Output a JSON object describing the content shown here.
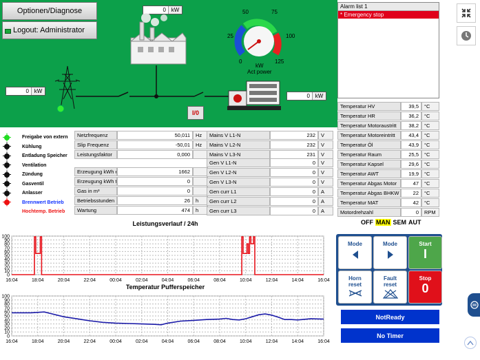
{
  "header": {
    "options_label": "Optionen/Diagnose",
    "logout_label": "Logout: Administrator"
  },
  "schematic": {
    "top_kw": {
      "value": "0",
      "unit": "kW"
    },
    "left_kw": {
      "value": "0",
      "unit": "kW"
    },
    "right_kw": {
      "value": "0",
      "unit": "kW"
    },
    "toggle_label": "I/0",
    "gauge": {
      "ticks": [
        "0",
        "25",
        "50",
        "75",
        "100",
        "125"
      ],
      "unit": "kW",
      "caption": "Act power",
      "value": 0,
      "max": 125
    }
  },
  "alarm": {
    "title": "Alarm list 1",
    "items": [
      "* Emergency stop"
    ]
  },
  "status": [
    {
      "label": "Freigabe von extern",
      "color": "#22dd22",
      "text_color": "#000000"
    },
    {
      "label": "Kühlung",
      "color": "#111111",
      "text_color": "#000000"
    },
    {
      "label": "Entladung Speicher",
      "color": "#111111",
      "text_color": "#000000"
    },
    {
      "label": "Ventilation",
      "color": "#111111",
      "text_color": "#000000"
    },
    {
      "label": "Zündung",
      "color": "#111111",
      "text_color": "#000000"
    },
    {
      "label": "Gasventil",
      "color": "#111111",
      "text_color": "#000000"
    },
    {
      "label": "Anlasser",
      "color": "#111111",
      "text_color": "#000000"
    },
    {
      "label": "Brennwert Betrieb",
      "color": "#ee1111",
      "text_color": "#1133ff"
    },
    {
      "label": "Hochtemp. Betrieb",
      "color": "",
      "text_color": "#ee1111"
    }
  ],
  "grid_table": [
    {
      "label": "Netzfrequenz",
      "value": "50,011",
      "unit": "Hz"
    },
    {
      "label": "Slip Frequenz",
      "value": "-50,01",
      "unit": "Hz"
    },
    {
      "label": "Leistungsfaktor",
      "value": "0,000",
      "unit": ""
    }
  ],
  "energy_table": [
    {
      "label": "Erzeugung kWh el",
      "value": "1662",
      "unit": ""
    },
    {
      "label": "Erzeugung kWh th",
      "value": "0",
      "unit": ""
    },
    {
      "label": "Gas in m³",
      "value": "0",
      "unit": ""
    },
    {
      "label": "Betriebsstunden",
      "value": "26",
      "unit": "h"
    },
    {
      "label": "Wartung",
      "value": "474",
      "unit": "h"
    }
  ],
  "mains_table": [
    {
      "label": "Mains V L1-N",
      "value": "232",
      "unit": "V"
    },
    {
      "label": "Mains V L2-N",
      "value": "232",
      "unit": "V"
    },
    {
      "label": "Mains V L3-N",
      "value": "231",
      "unit": "V"
    }
  ],
  "gen_table": [
    {
      "label": "Gen V L1-N",
      "value": "0",
      "unit": "V"
    },
    {
      "label": "Gen V L2-N",
      "value": "0",
      "unit": "V"
    },
    {
      "label": "Gen V L3-N",
      "value": "0",
      "unit": "V"
    },
    {
      "label": "Gen curr L1",
      "value": "0",
      "unit": "A"
    },
    {
      "label": "Gen curr L2",
      "value": "0",
      "unit": "A"
    },
    {
      "label": "Gen curr L3",
      "value": "0",
      "unit": "A"
    }
  ],
  "temp_table": [
    {
      "label": "Temperatur HV",
      "value": "39,5",
      "unit": "°C"
    },
    {
      "label": "Temperatur HR",
      "value": "36,2",
      "unit": "°C"
    },
    {
      "label": "Temperatur Motoraustritt",
      "value": "38,2",
      "unit": "°C"
    },
    {
      "label": "Temperatur Motoreintritt",
      "value": "43,4",
      "unit": "°C"
    },
    {
      "label": "Temperatur Öl",
      "value": "43,9",
      "unit": "°C"
    },
    {
      "label": "Temperatur Raum",
      "value": "25,5",
      "unit": "°C"
    },
    {
      "label": "Temperatur Kapsel",
      "value": "29,6",
      "unit": "°C"
    },
    {
      "label": "Temperatur AWT",
      "value": "19,9",
      "unit": "°C"
    },
    {
      "label": "Temperatur Abgas Motor",
      "value": "47",
      "unit": "°C"
    },
    {
      "label": "Temperatur Abgas BHKW",
      "value": "22",
      "unit": "°C"
    },
    {
      "label": "Temperatur MAT",
      "value": "42",
      "unit": "°C"
    },
    {
      "label": "Motordrehzahl",
      "value": "0",
      "unit": "RPM"
    }
  ],
  "modes": {
    "off": "OFF",
    "man": "MAN",
    "sem": "SEM",
    "aut": "AUT",
    "active": "MAN",
    "active_color": "#ffff00"
  },
  "controls": {
    "mode_left": "Mode",
    "mode_right": "Mode",
    "start": "Start",
    "start_symbol": "I",
    "horn_reset": "Horn reset",
    "fault_reset": "Fault reset",
    "stop": "Stop",
    "stop_symbol": "0",
    "status1": "NotReady",
    "status2": "No Timer"
  },
  "chart_data": [
    {
      "type": "line",
      "title": "Leistungsverlauf / 24h",
      "xlabel": "",
      "ylabel": "",
      "ylim": [
        0,
        100
      ],
      "yticks": [
        0,
        10,
        20,
        30,
        40,
        50,
        60,
        70,
        80,
        90,
        100
      ],
      "xticks": [
        "16:04",
        "18:04",
        "20:04",
        "22:04",
        "00:04",
        "02:04",
        "04:04",
        "06:04",
        "08:04",
        "10:04",
        "12:04",
        "14:04",
        "16:04"
      ],
      "grid": true,
      "series": [
        {
          "color": "#e8141c",
          "points": [
            [
              0,
              0
            ],
            [
              1.75,
              0
            ],
            [
              1.75,
              98
            ],
            [
              1.85,
              98
            ],
            [
              1.85,
              55
            ],
            [
              2.2,
              55
            ],
            [
              2.2,
              98
            ],
            [
              2.3,
              98
            ],
            [
              2.3,
              0
            ],
            [
              17.7,
              0
            ],
            [
              17.7,
              98
            ],
            [
              17.8,
              98
            ],
            [
              17.8,
              55
            ],
            [
              18.1,
              55
            ],
            [
              18.1,
              80
            ],
            [
              18.2,
              80
            ],
            [
              18.2,
              55
            ],
            [
              18.3,
              55
            ],
            [
              18.3,
              98
            ],
            [
              18.4,
              98
            ],
            [
              18.4,
              80
            ],
            [
              18.6,
              80
            ],
            [
              18.6,
              98
            ],
            [
              18.7,
              98
            ],
            [
              18.7,
              0
            ],
            [
              24,
              0
            ]
          ]
        }
      ]
    },
    {
      "type": "line",
      "title": "Temperatur Pufferspeicher",
      "xlabel": "",
      "ylabel": "",
      "ylim": [
        0,
        100
      ],
      "yticks": [
        0,
        10,
        20,
        30,
        40,
        50,
        60,
        70,
        80,
        90,
        100
      ],
      "xticks": [
        "16:04",
        "18:04",
        "20:04",
        "22:04",
        "00:04",
        "02:04",
        "04:04",
        "06:04",
        "08:04",
        "10:04",
        "12:04",
        "14:04",
        "16:04"
      ],
      "grid": true,
      "series": [
        {
          "color": "#1a1aa8",
          "points": [
            [
              0,
              58
            ],
            [
              1.5,
              58
            ],
            [
              2.5,
              60
            ],
            [
              3,
              56
            ],
            [
              4,
              48
            ],
            [
              5,
              43
            ],
            [
              6,
              38
            ],
            [
              7,
              34
            ],
            [
              8,
              32
            ],
            [
              9,
              31
            ],
            [
              10,
              30
            ],
            [
              11,
              29
            ],
            [
              11.5,
              28
            ],
            [
              12,
              32
            ],
            [
              13,
              37
            ],
            [
              14,
              39
            ],
            [
              15,
              41
            ],
            [
              16,
              42
            ],
            [
              16.5,
              44
            ],
            [
              17,
              41
            ],
            [
              17.5,
              40
            ],
            [
              18,
              43
            ],
            [
              18.5,
              48
            ],
            [
              19,
              53
            ],
            [
              19.5,
              55
            ],
            [
              20,
              52
            ],
            [
              20.5,
              47
            ],
            [
              21,
              41
            ],
            [
              21.5,
              41
            ],
            [
              22,
              40
            ],
            [
              23,
              43
            ],
            [
              24,
              42
            ]
          ]
        }
      ]
    }
  ]
}
